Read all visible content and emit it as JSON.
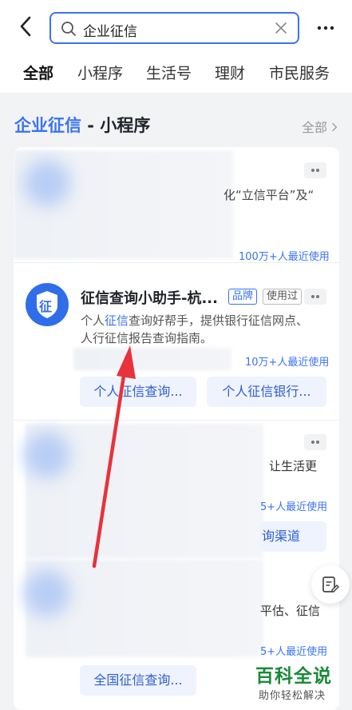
{
  "search": {
    "query": "企业征信"
  },
  "tabs": [
    "全部",
    "小程序",
    "生活号",
    "理财",
    "市民服务"
  ],
  "section": {
    "title_highlight": "企业征信",
    "title_suffix": " - 小程序",
    "more_label": "全部"
  },
  "results": [
    {
      "desc_partial": "化“立信平台”及“",
      "usage": "100万+人最近使用"
    },
    {
      "logo_char": "征",
      "title": "征信查询小助手-杭...",
      "tag_brand": "品牌",
      "tag_used": "使用过",
      "desc_pre": "个人",
      "desc_hl": "征信",
      "desc_post": "查询好帮手，提供银行征信网点、",
      "desc_line2": "人行征信报告查询指南。",
      "usage": "10万+人最近使用",
      "buttons": [
        "个人征信查询...",
        "个人征信银行..."
      ]
    },
    {
      "desc_partial": "让生活更",
      "usage_partial": "5+人最近使用",
      "button_partial": "询渠道"
    },
    {
      "desc_partial": "平估、征信",
      "usage_partial": "5+人最近使用",
      "button": "全国征信查询..."
    }
  ],
  "watermark": {
    "title": "百科全说",
    "subtitle": "助你轻松解决"
  },
  "colors": {
    "accent": "#3a73f2",
    "arrow": "#e8323c",
    "watermark": "#1a8a3a"
  }
}
